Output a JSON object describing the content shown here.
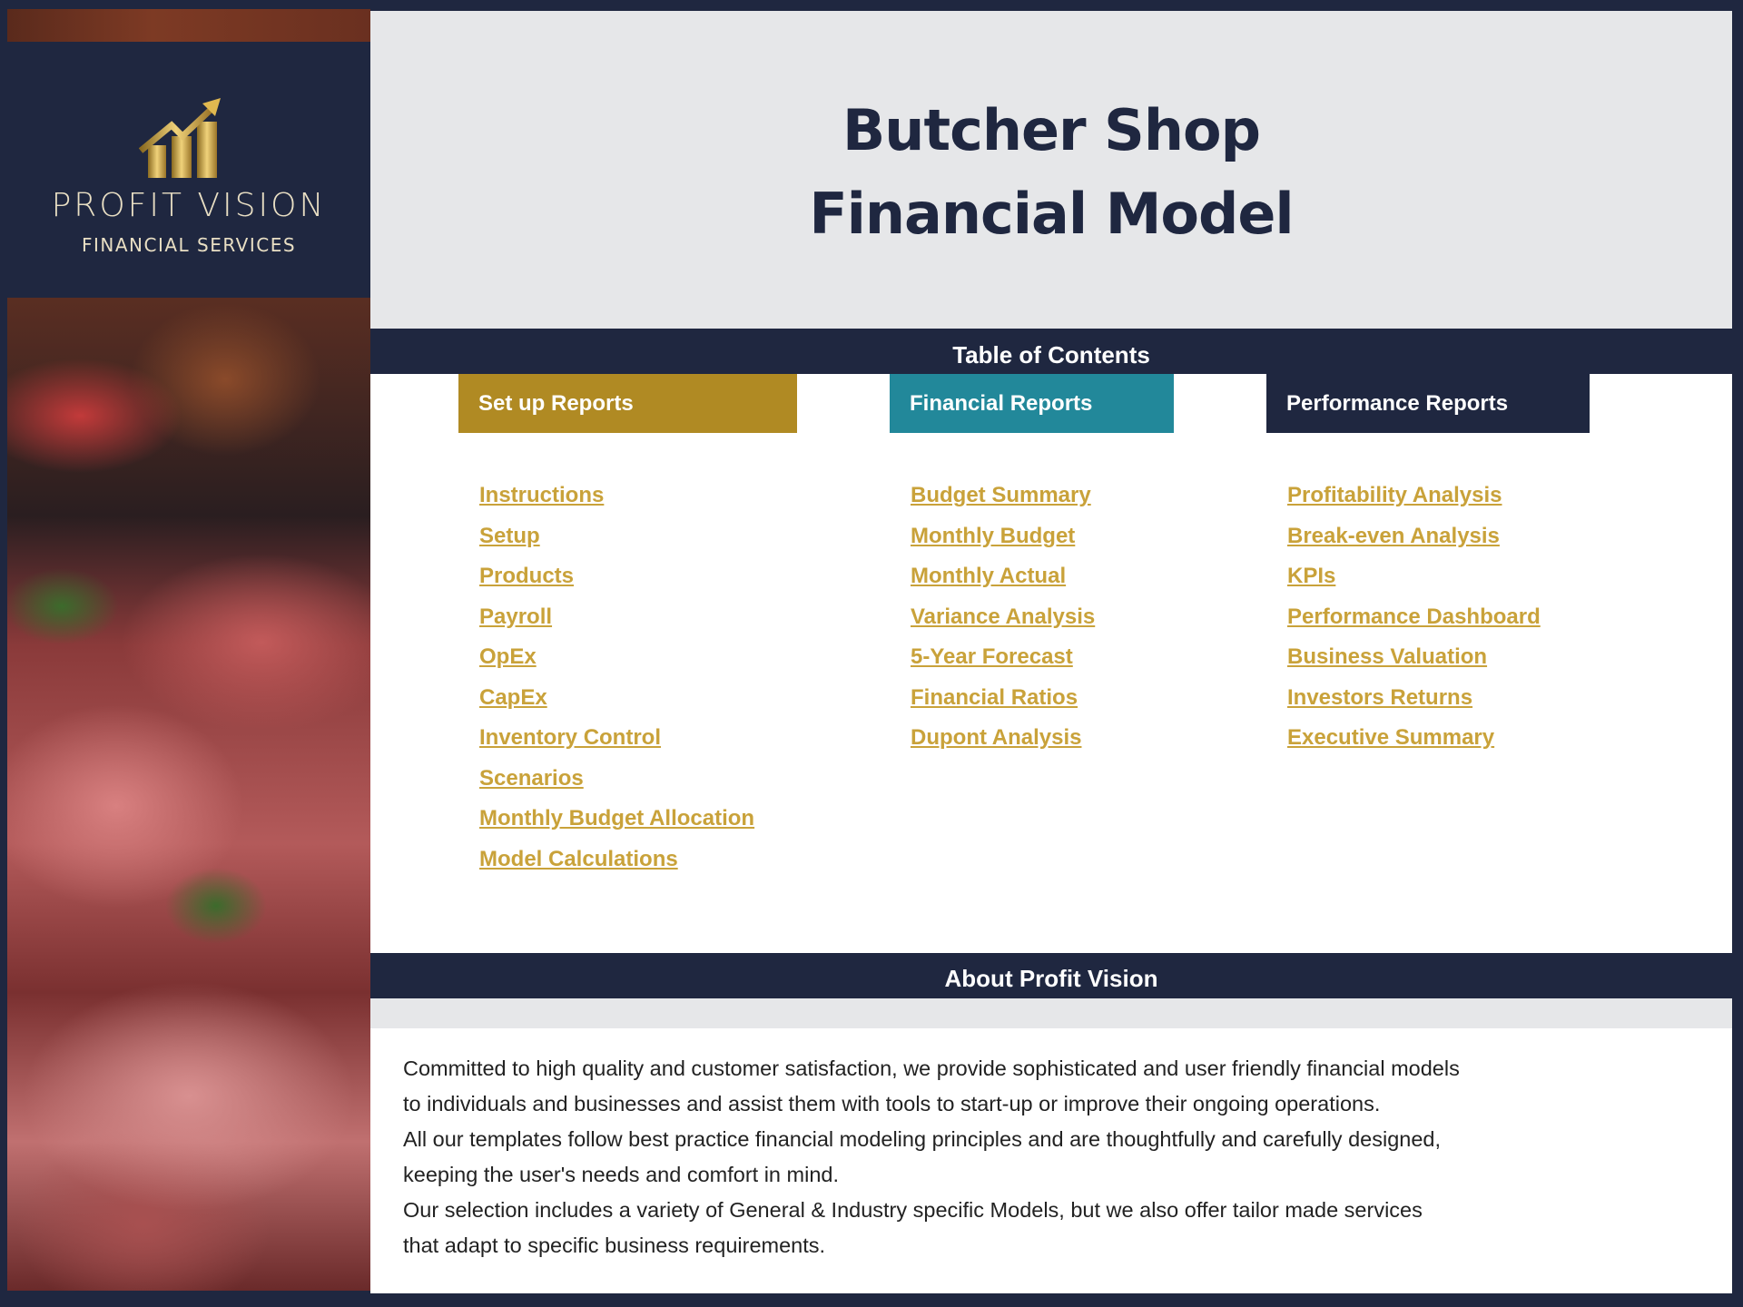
{
  "brand": {
    "name": "PROFIT VISION",
    "tagline": "FINANCIAL SERVICES",
    "logo_icon": "rising-bar-chart-arrow-icon",
    "gold": "#c9a23a"
  },
  "header": {
    "title_line1": "Butcher Shop",
    "title_line2": "Financial Model"
  },
  "toc": {
    "title": "Table of Contents",
    "columns": [
      {
        "label": "Set up Reports",
        "color": "#b08a23",
        "items": [
          "Instructions",
          "Setup",
          "Products",
          "Payroll",
          "OpEx",
          "CapEx",
          "Inventory Control",
          "Scenarios",
          "Monthly Budget Allocation",
          "Model Calculations"
        ]
      },
      {
        "label": "Financial Reports",
        "color": "#22889a",
        "items": [
          "Budget Summary",
          "Monthly Budget",
          "Monthly Actual",
          "Variance Analysis",
          "5-Year Forecast",
          "Financial Ratios",
          "Dupont Analysis"
        ]
      },
      {
        "label": "Performance Reports",
        "color": "#1f2740",
        "items": [
          "Profitability Analysis",
          "Break-even Analysis",
          "KPIs",
          "Performance Dashboard",
          "Business Valuation",
          "Investors Returns",
          "Executive Summary"
        ]
      }
    ]
  },
  "about": {
    "title": "About Profit Vision",
    "lines": [
      "Committed to high quality and customer satisfaction, we provide sophisticated and user friendly financial models",
      "to individuals and businesses and assist them  with tools to start-up or improve their ongoing operations.",
      "All our templates follow best practice financial modeling principles and are thoughtfully and carefully designed,",
      "keeping the user's needs and comfort in mind.",
      "Our selection includes a variety of General & Industry specific Models, but we also offer tailor made services",
      "that adapt to specific business requirements."
    ]
  }
}
